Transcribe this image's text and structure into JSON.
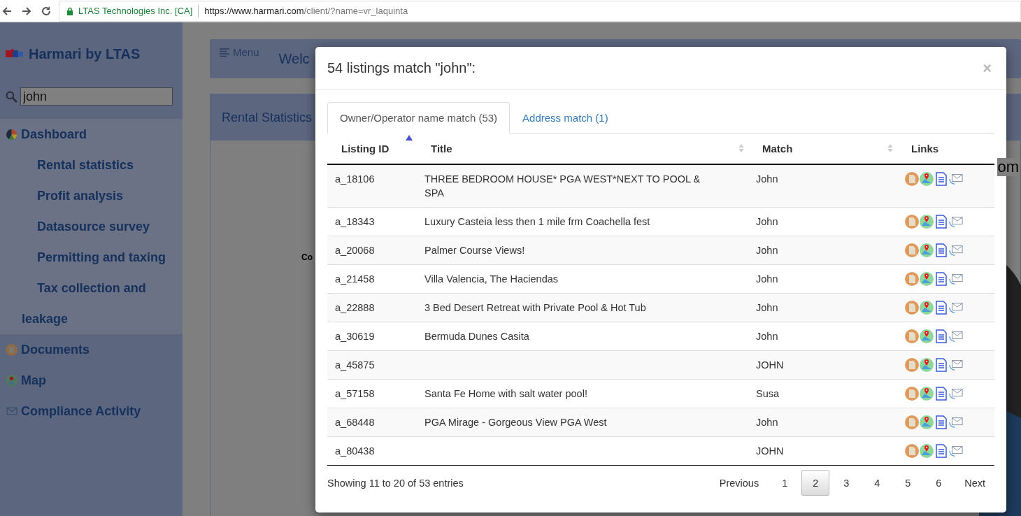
{
  "browser": {
    "site_identity": "LTAS Technologies Inc. [CA]",
    "url_host": "https://www.harmari.com",
    "url_path": "/client/?name=vr_laquinta"
  },
  "sidebar": {
    "brand": "Harmari by LTAS",
    "search": {
      "value": "john"
    },
    "items": [
      {
        "kind": "dashboard",
        "label": "Dashboard",
        "expanded": true,
        "children": [
          {
            "label": "Rental statistics"
          },
          {
            "label": "Profit analysis"
          },
          {
            "label": "Datasource survey"
          },
          {
            "label": "Permitting and taxing"
          },
          {
            "label": "Tax collection and leakage"
          }
        ]
      },
      {
        "kind": "documents",
        "label": "Documents",
        "expanded": false
      },
      {
        "kind": "map",
        "label": "Map",
        "expanded": false
      },
      {
        "kind": "compliance",
        "label": "Compliance Activity",
        "expanded": false
      }
    ]
  },
  "main": {
    "menu_button": "Menu",
    "welcome": "Welc",
    "panel_title": "Rental Statistics",
    "chart_label": "Co",
    "right_label": "om"
  },
  "modal": {
    "title": "54 listings match \"john\":",
    "close": "×",
    "tabs": [
      {
        "label": "Owner/Operator name match (53)",
        "selected": true
      },
      {
        "label": "Address match (1)",
        "selected": false
      }
    ],
    "table": {
      "columns": [
        {
          "label": "Listing ID",
          "sortable": true,
          "sorted": true
        },
        {
          "label": "Title",
          "sortable": true,
          "sorted": false
        },
        {
          "label": "Match",
          "sortable": true,
          "sorted": false
        },
        {
          "label": "Links",
          "sortable": false
        }
      ],
      "rows": [
        {
          "listing_id": "a_18106",
          "title": "THREE BEDROOM HOUSE* PGA WEST*NEXT TO POOL & SPA",
          "match": "John"
        },
        {
          "listing_id": "a_18343",
          "title": "Luxury Casteia less then 1 mile frm Coachella fest",
          "match": "John"
        },
        {
          "listing_id": "a_20068",
          "title": "Palmer Course Views!",
          "match": "John"
        },
        {
          "listing_id": "a_21458",
          "title": "Villa Valencia, The Haciendas",
          "match": "John"
        },
        {
          "listing_id": "a_22888",
          "title": "3 Bed Desert Retreat with Private Pool & Hot Tub",
          "match": "John"
        },
        {
          "listing_id": "a_30619",
          "title": "Bermuda Dunes Casita",
          "match": "John"
        },
        {
          "listing_id": "a_45875",
          "match": "JOHN"
        },
        {
          "listing_id": "a_57158",
          "title": "Santa Fe Home with salt water pool!",
          "match": "Susa"
        },
        {
          "listing_id": "a_68448",
          "title": "PGA Mirage - Gorgeous View PGA West",
          "match": "John"
        },
        {
          "listing_id": "a_80438",
          "match": "JOHN"
        }
      ]
    },
    "info": "Showing 11 to 20 of 53 entries",
    "pagination": {
      "previous": "Previous",
      "next": "Next",
      "pages": [
        {
          "label": "1",
          "selected": false
        },
        {
          "label": "2",
          "selected": true
        },
        {
          "label": "3",
          "selected": false
        },
        {
          "label": "4",
          "selected": false
        },
        {
          "label": "5",
          "selected": false
        },
        {
          "label": "6",
          "selected": false
        }
      ]
    }
  }
}
